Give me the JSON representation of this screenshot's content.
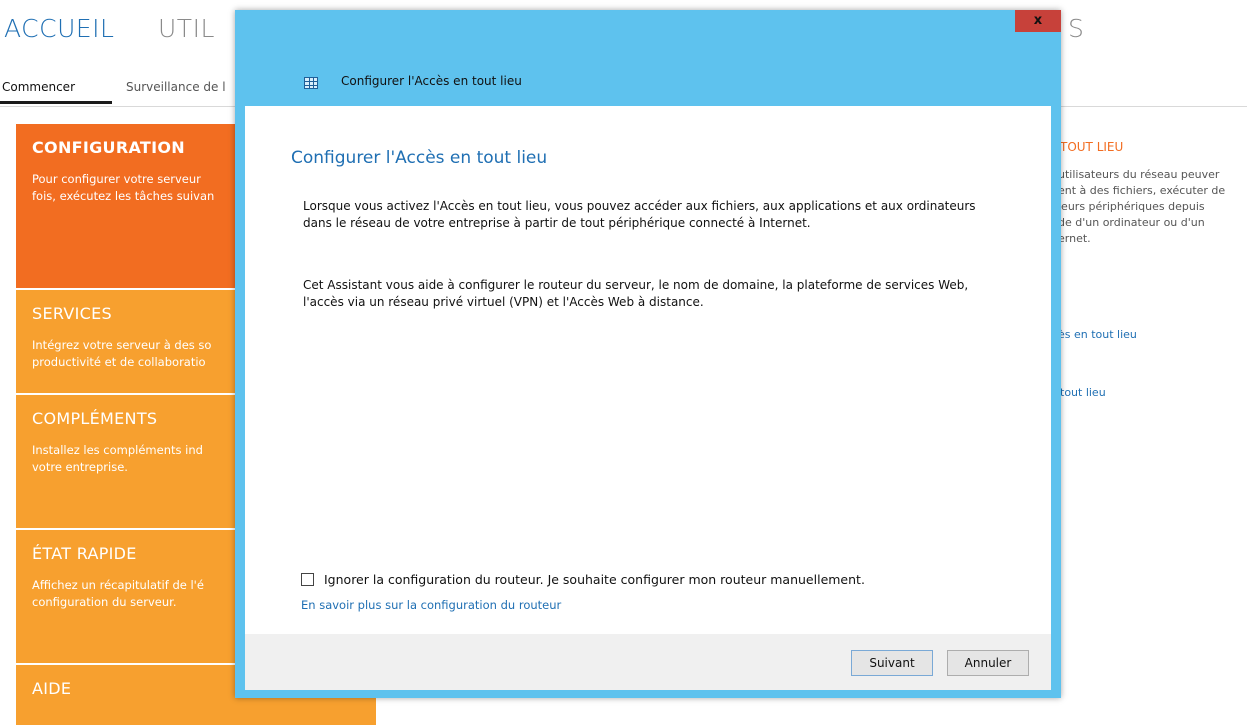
{
  "nav": {
    "accueil": "ACCUEIL",
    "util_partial": "UTIL",
    "right_partial": "S"
  },
  "subtabs": {
    "active": "Commencer",
    "other": "Surveillance de l"
  },
  "tiles": [
    {
      "title": "CONFIGURATION",
      "text": "Pour configurer votre serveur\nfois, exécutez les tâches suivan"
    },
    {
      "title": "SERVICES",
      "text": "Intégrez votre serveur à des so\nproductivité et de collaboratio"
    },
    {
      "title": "COMPLÉMENTS",
      "text": "Installez les compléments ind\nvotre entreprise."
    },
    {
      "title": "ÉTAT RAPIDE",
      "text": "Affichez un récapitulatif de l'é\nconfiguration du serveur."
    },
    {
      "title": "AIDE",
      "text": ""
    }
  ],
  "right_panel": {
    "title": "TOUT LIEU",
    "text": "utilisateurs du réseau peuver\nent à des fichiers, exécuter de\nleurs périphériques depuis\nde d'un ordinateur ou d'un\nernet.",
    "link1": "ès en tout lieu",
    "link2": "tout lieu"
  },
  "dialog": {
    "window_title": "Configurer l'Accès en tout lieu",
    "close_label": "x",
    "heading": "Configurer l'Accès en tout lieu",
    "paragraph1": "Lorsque vous activez l'Accès en tout lieu, vous pouvez accéder aux fichiers, aux applications et aux ordinateurs dans le réseau de votre entreprise à partir de tout périphérique connecté à Internet.",
    "paragraph2": "Cet Assistant vous aide à configurer le routeur du serveur, le nom de domaine, la plateforme de services Web, l'accès via un réseau privé virtuel (VPN) et l'Accès Web à distance.",
    "checkbox_label": "Ignorer la configuration du routeur. Je souhaite configurer mon routeur manuellement.",
    "checkbox_checked": false,
    "learn_more": "En savoir plus sur la configuration du routeur",
    "next_button": "Suivant",
    "cancel_button": "Annuler"
  },
  "colors": {
    "accent_orange": "#f26d21",
    "tile_orange": "#f7a02f",
    "window_frame": "#5ec2ee",
    "link_blue": "#1f6fb3",
    "close_red": "#c7413a"
  }
}
